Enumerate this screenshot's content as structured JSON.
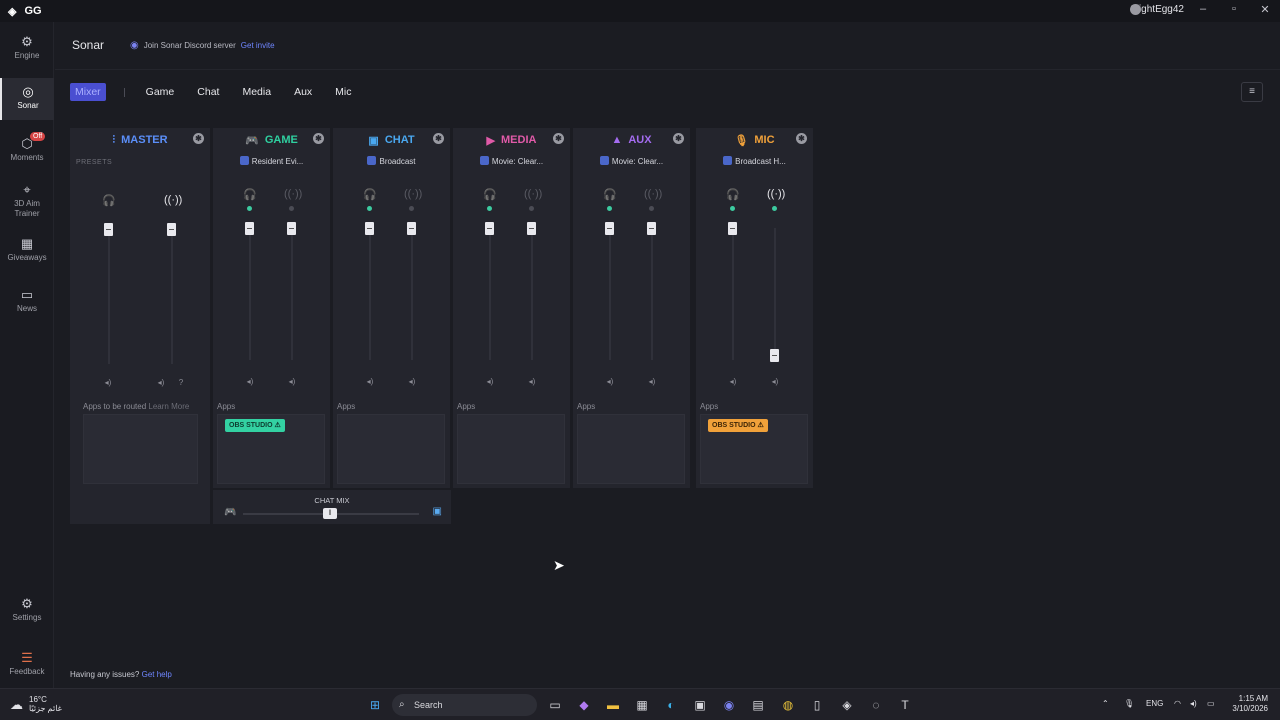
{
  "app": {
    "logo": "GG",
    "user": "SlightEgg42"
  },
  "sidebar": {
    "items": [
      {
        "label": "Engine",
        "icon": "engine-icon"
      },
      {
        "label": "Sonar",
        "icon": "sonar-icon"
      },
      {
        "label": "Moments",
        "icon": "moments-icon",
        "badge": "Off"
      },
      {
        "label": "3D Aim",
        "label2": "Trainer",
        "icon": "aim-icon"
      },
      {
        "label": "Giveaways",
        "icon": "gift-icon"
      },
      {
        "label": "News",
        "icon": "news-icon"
      },
      {
        "label": "Settings",
        "icon": "gear-icon"
      },
      {
        "label": "Feedback",
        "icon": "feedback-icon"
      }
    ]
  },
  "header": {
    "title": "Sonar",
    "discord_text": "Join Sonar Discord server",
    "discord_link": "Get invite"
  },
  "tabs": [
    "Mixer",
    "Game",
    "Chat",
    "Media",
    "Aux",
    "Mic"
  ],
  "channels": {
    "master": {
      "name": "MASTER",
      "presets": "PRESETS",
      "apps_label": "Apps to be routed",
      "learn": "Learn More",
      "color": "#5b8ff9"
    },
    "game": {
      "name": "GAME",
      "device": "Resident Evi...",
      "apps_label": "Apps",
      "chip": "OBS STUDIO",
      "color": "#2fd0a0"
    },
    "chat": {
      "name": "CHAT",
      "device": "Broadcast",
      "apps_label": "Apps",
      "color": "#4aa8f0"
    },
    "media": {
      "name": "MEDIA",
      "device": "Movie: Clear...",
      "apps_label": "Apps",
      "color": "#e05aa8"
    },
    "aux": {
      "name": "AUX",
      "device": "Movie: Clear...",
      "apps_label": "Apps",
      "color": "#a46cf0"
    },
    "mic": {
      "name": "MIC",
      "device": "Broadcast H...",
      "apps_label": "Apps",
      "chip": "OBS STUDIO",
      "color": "#f0a13a"
    }
  },
  "chat_mix": {
    "label": "CHAT MIX"
  },
  "footer": {
    "text": "Having any issues?",
    "link": "Get help"
  },
  "taskbar": {
    "temp": "16°C",
    "weather_desc": "غائم جزئيًا",
    "search": "Search",
    "lang": "ENG",
    "time": "1:15 AM",
    "date": "3/10/2026"
  }
}
